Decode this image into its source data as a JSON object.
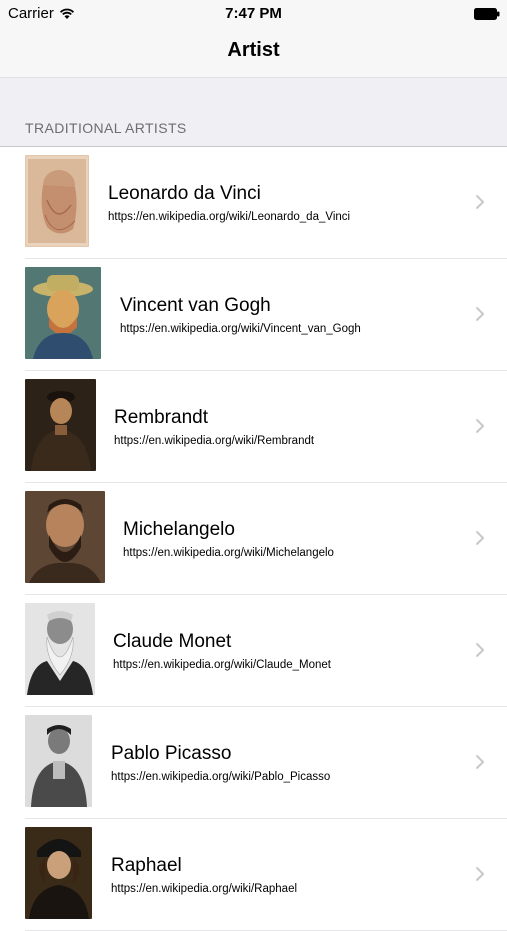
{
  "status_bar": {
    "carrier": "Carrier",
    "time": "7:47 PM"
  },
  "nav": {
    "title": "Artist"
  },
  "section": {
    "header": "TRADITIONAL ARTISTS"
  },
  "artists": [
    {
      "name": "Leonardo da Vinci",
      "url": "https://en.wikipedia.org/wiki/Leonardo_da_Vinci"
    },
    {
      "name": "Vincent van Gogh",
      "url": "https://en.wikipedia.org/wiki/Vincent_van_Gogh"
    },
    {
      "name": "Rembrandt",
      "url": "https://en.wikipedia.org/wiki/Rembrandt"
    },
    {
      "name": "Michelangelo",
      "url": "https://en.wikipedia.org/wiki/Michelangelo"
    },
    {
      "name": "Claude Monet",
      "url": "https://en.wikipedia.org/wiki/Claude_Monet"
    },
    {
      "name": "Pablo Picasso",
      "url": "https://en.wikipedia.org/wiki/Pablo_Picasso"
    },
    {
      "name": "Raphael",
      "url": "https://en.wikipedia.org/wiki/Raphael"
    }
  ]
}
